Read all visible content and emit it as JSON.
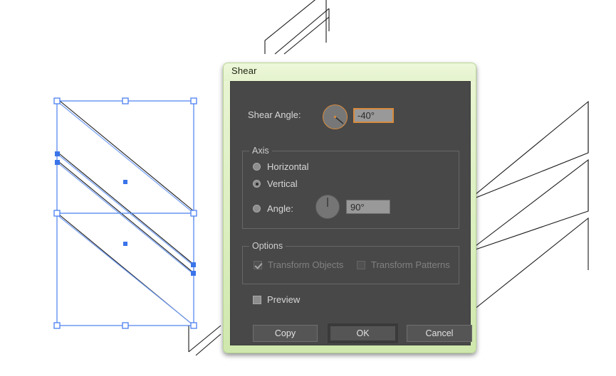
{
  "dialog": {
    "title": "Shear",
    "shear_angle": {
      "label": "Shear Angle:",
      "value": "-40°",
      "dial_icon": "angle-dial-icon",
      "dial_degrees": -40
    },
    "axis": {
      "legend": "Axis",
      "options": [
        {
          "label": "Horizontal",
          "selected": false
        },
        {
          "label": "Vertical",
          "selected": true
        },
        {
          "label": "Angle:",
          "selected": false
        }
      ],
      "angle_value": "90°",
      "angle_dial_icon": "angle-dial-icon",
      "angle_dial_degrees": 90
    },
    "options": {
      "legend": "Options",
      "transform_objects": {
        "label": "Transform Objects",
        "checked": true,
        "disabled": true
      },
      "transform_patterns": {
        "label": "Transform Patterns",
        "checked": false,
        "disabled": true
      }
    },
    "preview": {
      "label": "Preview",
      "checked": false
    },
    "buttons": {
      "copy": "Copy",
      "ok": "OK",
      "cancel": "Cancel"
    },
    "colors": {
      "titlebar": "#e5f3cd",
      "frame": "#cfe8ad",
      "panel": "#484848",
      "focus_accent": "#d98b3d",
      "field_bg": "#999999",
      "text": "#d7d7d7"
    }
  },
  "canvas": {
    "selection_color": "#4a7ff0",
    "stroke_color": "#1a1a1a",
    "background": "#ffffff",
    "selected_object": "sheared-chevron-paths",
    "handles": {
      "bounding_box_handle": "hollow-square-handle",
      "anchor_point": "solid-square-anchor"
    }
  }
}
